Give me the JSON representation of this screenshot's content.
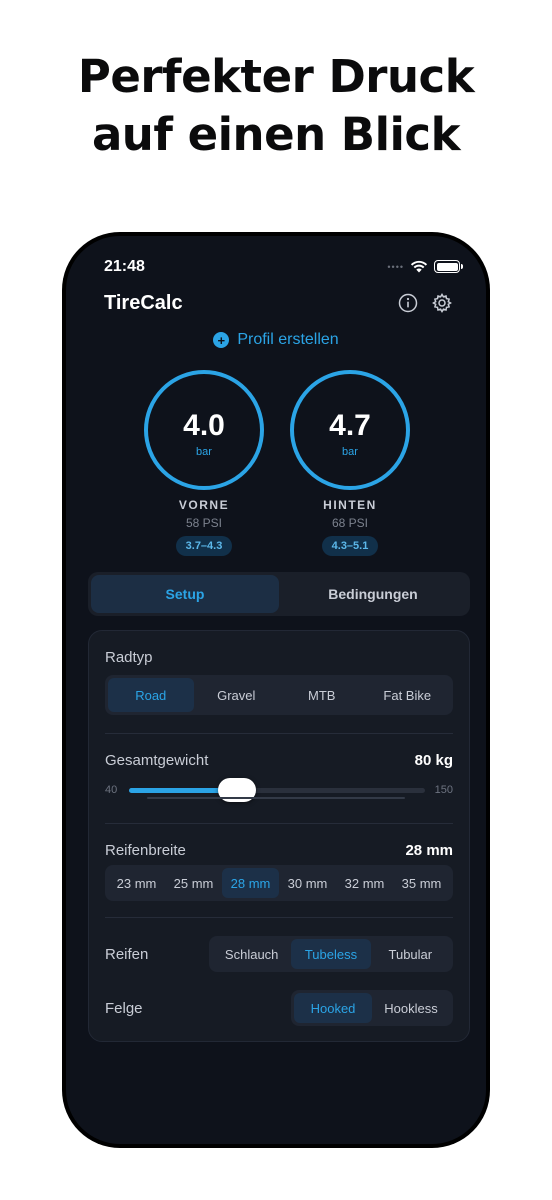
{
  "headline": {
    "line1": "Perfekter Druck",
    "line2": "auf einen Blick"
  },
  "status": {
    "time": "21:48"
  },
  "app": {
    "title": "TireCalc"
  },
  "profile": {
    "create_label": "Profil erstellen"
  },
  "gauges": {
    "front": {
      "value": "4.0",
      "unit": "bar",
      "label": "VORNE",
      "psi": "58 PSI",
      "range": "3.7–4.3"
    },
    "rear": {
      "value": "4.7",
      "unit": "bar",
      "label": "HINTEN",
      "psi": "68 PSI",
      "range": "4.3–5.1"
    }
  },
  "tabs": [
    {
      "label": "Setup",
      "active": true
    },
    {
      "label": "Bedingungen",
      "active": false
    }
  ],
  "bike_type": {
    "label": "Radtyp",
    "options": [
      "Road",
      "Gravel",
      "MTB",
      "Fat Bike"
    ],
    "selected": "Road"
  },
  "total_weight": {
    "label": "Gesamtgewicht",
    "value": "80 kg",
    "min": "40",
    "max": "150",
    "current": 80
  },
  "tire_width": {
    "label": "Reifenbreite",
    "value": "28 mm",
    "options": [
      "23 mm",
      "25 mm",
      "28 mm",
      "30 mm",
      "32 mm",
      "35 mm"
    ],
    "selected": "28 mm"
  },
  "tire_type": {
    "label": "Reifen",
    "options": [
      "Schlauch",
      "Tubeless",
      "Tubular"
    ],
    "selected": "Tubeless"
  },
  "rim": {
    "label": "Felge",
    "options": [
      "Hooked",
      "Hookless"
    ],
    "selected": "Hooked"
  },
  "colors": {
    "accent": "#2ba4e6",
    "background": "#0e121b",
    "card": "#161b24"
  }
}
